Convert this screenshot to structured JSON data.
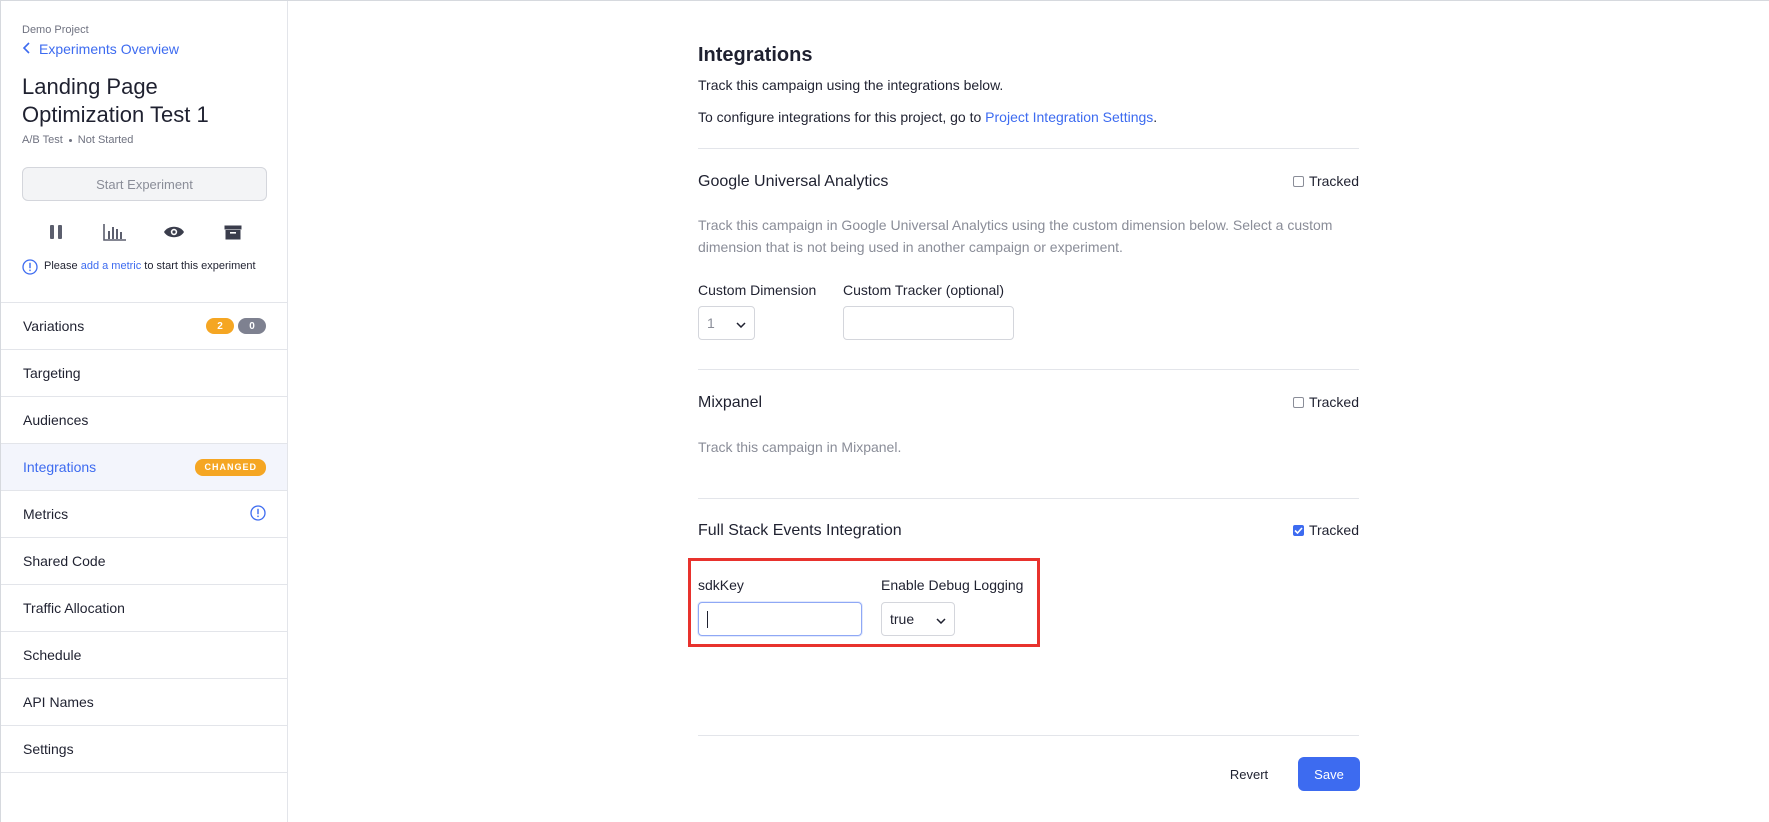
{
  "sidebar": {
    "project": "Demo Project",
    "back_label": "Experiments Overview",
    "title": "Landing Page Optimization Test 1",
    "type": "A/B Test",
    "status": "Not Started",
    "start_button": "Start Experiment",
    "notice": {
      "prefix": "Please ",
      "link": "add a metric",
      "suffix": " to start this experiment"
    },
    "toolbar": [
      "pause-icon",
      "results-chart-icon",
      "preview-eye-icon",
      "archive-icon"
    ],
    "nav": [
      {
        "label": "Variations",
        "badges": [
          "2",
          "0"
        ]
      },
      {
        "label": "Targeting"
      },
      {
        "label": "Audiences"
      },
      {
        "label": "Integrations",
        "tag": "CHANGED",
        "active": true
      },
      {
        "label": "Metrics",
        "icon": "info-icon"
      },
      {
        "label": "Shared Code"
      },
      {
        "label": "Traffic Allocation"
      },
      {
        "label": "Schedule"
      },
      {
        "label": "API Names"
      },
      {
        "label": "Settings"
      }
    ]
  },
  "main": {
    "heading": "Integrations",
    "intro": "Track this campaign using the integrations below.",
    "configure_prefix": "To configure integrations for this project, go to ",
    "configure_link": "Project Integration Settings",
    "configure_suffix": ".",
    "tracked_label": "Tracked",
    "google": {
      "title": "Google Universal Analytics",
      "tracked": false,
      "description": "Track this campaign in Google Universal Analytics using the custom dimension below. Select a custom dimension that is not being used in another campaign or experiment.",
      "custom_dimension_label": "Custom Dimension",
      "custom_dimension_value": "1",
      "custom_tracker_label": "Custom Tracker (optional)",
      "custom_tracker_value": ""
    },
    "mixpanel": {
      "title": "Mixpanel",
      "tracked": false,
      "description": "Track this campaign in Mixpanel."
    },
    "fullstack": {
      "title": "Full Stack Events Integration",
      "tracked": true,
      "sdkkey_label": "sdkKey",
      "sdkkey_value": "",
      "debug_label": "Enable Debug Logging",
      "debug_value": "true"
    },
    "revert_label": "Revert",
    "save_label": "Save"
  },
  "colors": {
    "accent": "#3d6bf0",
    "warning": "#f5a623",
    "highlight": "#e8322d"
  }
}
